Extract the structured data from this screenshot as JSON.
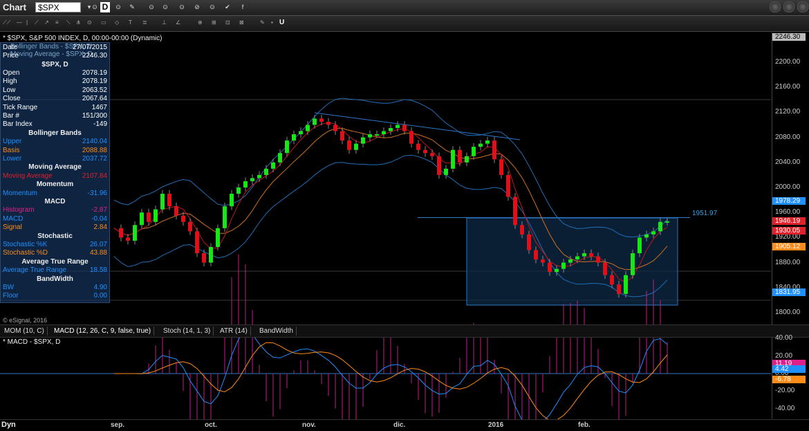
{
  "app": {
    "title": "Chart",
    "symbol": "$SPX",
    "interval": "D"
  },
  "chart": {
    "header": "* $SPX, S&P 500 INDEX, D, 00:00-00:00 (Dynamic)",
    "overlay1": "Bollinger Bands - $SPX, D",
    "overlay2": "Moving Average - $SPX, D",
    "copyright": "© eSignal, 2016",
    "hline_value": "1951.97"
  },
  "data_panel": {
    "date_label": "Date",
    "date_value": "27/07/2015",
    "price_label": "Price",
    "price_value": "2246.30",
    "symbol_header": "$SPX, D",
    "rows": [
      {
        "label": "Open",
        "value": "2078.19"
      },
      {
        "label": "High",
        "value": "2078.19"
      },
      {
        "label": "Low",
        "value": "2063.52"
      },
      {
        "label": "Close",
        "value": "2067.64"
      },
      {
        "label": "Tick Range",
        "value": "1467"
      },
      {
        "label": "Bar #",
        "value": "151/300"
      },
      {
        "label": "Bar Index",
        "value": "-149"
      }
    ],
    "bollinger_title": "Bollinger Bands",
    "bollinger": [
      {
        "label": "Upper",
        "value": "2140.04",
        "color": "#1e90ff"
      },
      {
        "label": "Basis",
        "value": "2088.88",
        "color": "#ff8c1a"
      },
      {
        "label": "Lower",
        "value": "2037.72",
        "color": "#1e90ff"
      }
    ],
    "ma_title": "Moving Average",
    "ma": {
      "label": "Moving Average",
      "value": "2107.84",
      "color": "#e0202a"
    },
    "momentum_title": "Momentum",
    "momentum": {
      "label": "Momentum",
      "value": "-31.96",
      "color": "#1e90ff"
    },
    "macd_title": "MACD",
    "macd": [
      {
        "label": "Histogram",
        "value": "-2.87",
        "color": "#e0208a"
      },
      {
        "label": "MACD",
        "value": "-0.04",
        "color": "#1e90ff"
      },
      {
        "label": "Signal",
        "value": "2.84",
        "color": "#ff8c1a"
      }
    ],
    "stoch_title": "Stochastic",
    "stoch": [
      {
        "label": "Stochastic %K",
        "value": "26.07",
        "color": "#1e90ff"
      },
      {
        "label": "Stochastic %D",
        "value": "43.88",
        "color": "#ff8c1a"
      }
    ],
    "atr_title": "Average True Range",
    "atr": {
      "label": "Average True Range",
      "value": "18.58",
      "color": "#1e90ff"
    },
    "bw_title": "BandWidth",
    "bw": [
      {
        "label": "BW",
        "value": "4.90",
        "color": "#1e90ff"
      },
      {
        "label": "Floor",
        "value": "0.00",
        "color": "#1e90ff"
      }
    ]
  },
  "price_axis": {
    "top_value": "2246.30",
    "labels": [
      "2200.00",
      "2160.00",
      "2120.00",
      "2080.00",
      "2040.00",
      "2000.00",
      "1960.00",
      "1920.00",
      "1880.00",
      "1840.00",
      "1800.00"
    ],
    "tags": [
      {
        "value": "1978.29",
        "color": "#1e90ff"
      },
      {
        "value": "1946.19",
        "color": "#e0202a"
      },
      {
        "value": "1930.05",
        "color": "#e0202a"
      },
      {
        "value": "1905.12",
        "color": "#ff8c1a"
      },
      {
        "value": "1831.95",
        "color": "#1e90ff"
      }
    ]
  },
  "tabs": [
    "MOM (10, C)",
    "MACD (12, 26, C, 9, false, true)",
    "Stoch (14, 1, 3)",
    "ATR (14)",
    "BandWidth"
  ],
  "macd_pane": {
    "title": "* MACD - $SPX, D",
    "axis_labels": [
      "40.00",
      "20.00",
      "0.00",
      "-20.00",
      "-40.00"
    ],
    "tags": [
      {
        "value": "11.19",
        "color": "#e0208a"
      },
      {
        "value": "4.42",
        "color": "#1e90ff"
      },
      {
        "value": "-6.78",
        "color": "#ff8c1a"
      }
    ]
  },
  "date_axis": {
    "labels": [
      "sep.",
      "oct.",
      "nov.",
      "dic.",
      "2016",
      "feb."
    ],
    "left_label": "Dyn"
  },
  "colors": {
    "up": "#19e619",
    "down": "#e0101a",
    "band": "#1f6fb8",
    "basis": "#d07020",
    "ma": "#c01818",
    "zone": "#0e2a44"
  }
}
